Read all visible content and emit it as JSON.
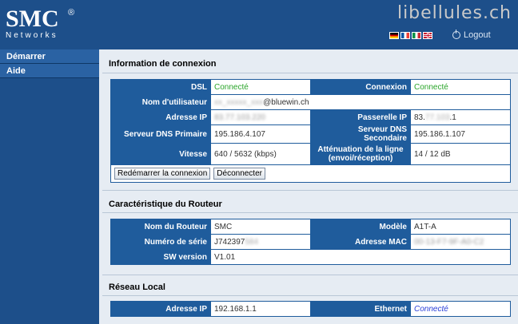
{
  "header": {
    "brand": "SMC",
    "brand_reg": "®",
    "brand_sub": "Networks",
    "watermark": "libellules.ch",
    "languages": [
      "de-flag",
      "fr-flag",
      "it-flag",
      "uk-flag"
    ],
    "logout_label": "Logout"
  },
  "sidebar": {
    "items": [
      {
        "label": "Démarrer"
      },
      {
        "label": "Aide"
      }
    ]
  },
  "connexion": {
    "title": "Information de connexion",
    "dsl_label": "DSL",
    "dsl_value": "Connecté",
    "connexion_label": "Connexion",
    "connexion_value": "Connecté",
    "user_label": "Nom d'utilisateur",
    "user_value_hidden": "xx_xxxxx_xxx",
    "user_value_domain": "@bluewin.ch",
    "ip_label": "Adresse IP",
    "ip_value": "83.77.103.220",
    "gateway_label": "Passerelle IP",
    "gateway_value_prefix": "83.",
    "gateway_value_hidden": "77.103",
    "gateway_value_suffix": ".1",
    "dns1_label": "Serveur DNS Primaire",
    "dns1_value": "195.186.4.107",
    "dns2_label": "Serveur DNS Secondaire",
    "dns2_value": "195.186.1.107",
    "speed_label": "Vitesse",
    "speed_value": "640 / 5632 (kbps)",
    "atten_label_1": "Atténuation de la ligne",
    "atten_label_2": "(envoi/réception)",
    "atten_value": "14 / 12 dB",
    "restart_button": "Redémarrer la connexion",
    "disconnect_button": "Déconnecter"
  },
  "router": {
    "title": "Caractéristique du Routeur",
    "name_label": "Nom du Routeur",
    "name_value": "SMC",
    "model_label": "Modèle",
    "model_value": "A1T-A",
    "serial_label": "Numéro de série",
    "serial_value": "J742397",
    "serial_hidden": "584",
    "mac_label": "Adresse MAC",
    "mac_value": "00-13-F7-9F-A0-C2",
    "sw_label": "SW version",
    "sw_value": "V1.01"
  },
  "lan": {
    "title": "Réseau Local",
    "ip_label": "Adresse IP",
    "ip_value": "192.168.1.1",
    "eth_label": "Ethernet",
    "eth_value": "Connecté"
  },
  "colors": {
    "header_bg": "#1d4f8a",
    "label_bg": "#1f5c9c",
    "connected_green": "#2aa52a",
    "connected_blue": "#2a3fd8",
    "page_bg": "#e6ecf3"
  }
}
